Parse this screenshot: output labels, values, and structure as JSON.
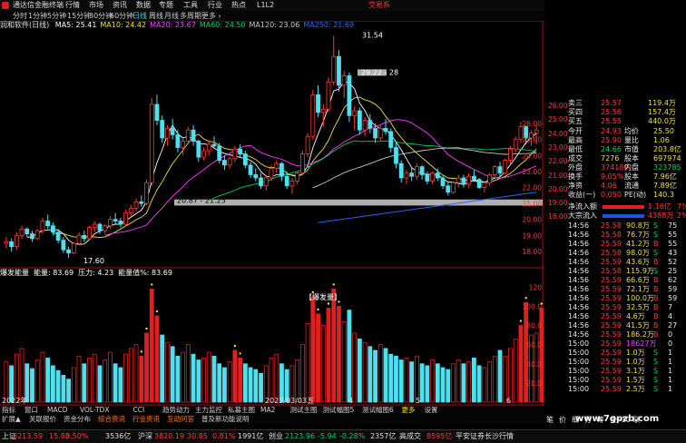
{
  "window": {
    "title": "通达信金融终端"
  },
  "menu": [
    "行情",
    "市场",
    "资讯",
    "数据",
    "专题",
    "工具",
    "行业",
    "热点",
    "L1L2"
  ],
  "menu_right": "交易系",
  "periods": [
    "分时",
    "1分钟",
    "5分钟",
    "15分钟",
    "30分钟",
    "60分钟",
    "日线",
    "周线",
    "月线",
    "多周期",
    "更多 ›"
  ],
  "ma_legend": {
    "name": "润和软件(日线)",
    "items": [
      {
        "t": "MA5: 25.41",
        "c": "#ffffff"
      },
      {
        "t": "MA10: 24.42",
        "c": "#f0e040"
      },
      {
        "t": "MA20: 23.67",
        "c": "#ff40ff"
      },
      {
        "t": "MA60: 24.50",
        "c": "#00d05a"
      },
      {
        "t": "MA120: 23.06",
        "c": "#c8c8c8"
      },
      {
        "t": "MA250: 21.69",
        "c": "#3060ff"
      }
    ]
  },
  "price_annotations": {
    "high": "31.54",
    "band": "29.22 - 28",
    "low": "17.60",
    "support": "20.87 - 21.25"
  },
  "axis_price": [
    "26.00",
    "25.00",
    "24.00",
    "23.00",
    "22.00",
    "21.00",
    "20.00",
    "19.00",
    "18.00"
  ],
  "axis_vol": [
    "120",
    "100.0",
    "80.0",
    "60.0",
    "40.0",
    "20.0"
  ],
  "vol_legend": {
    "items": [
      {
        "t": "爆发能量",
        "c": "#ffffff"
      },
      {
        "t": "能量: 83.69",
        "c": "#ffffff"
      },
      {
        "t": "压力: 4.23",
        "c": "#ffffff"
      },
      {
        "t": "能量值%: 83.69",
        "c": "#ffffff"
      }
    ]
  },
  "vol_signal": "【爆发量】",
  "xaxis": {
    "d1": "2022年",
    "d2": "2023/03/03五",
    "m4": "4",
    "m5": "5",
    "m6": "6"
  },
  "tabs": [
    "指标",
    "窗口",
    "MACD",
    "VOL-TDX",
    "CCI",
    "趋势动力",
    "主力监控",
    "私募主图",
    "MA2",
    "测试主图",
    "测试幅图5",
    "测试幅图6",
    "更多",
    "设置"
  ],
  "tabs2": [
    "扩展▲",
    "关联报价",
    "资金分布",
    "综合资讯",
    "行业资讯",
    "互动问答",
    "普及新功能说明"
  ],
  "quote": {
    "asks": [
      {
        "l": "卖三",
        "p": "25.57",
        "v": "119.4万"
      },
      {
        "l": "买四",
        "p": "25.56",
        "v": "157.4万"
      },
      {
        "l": "买五",
        "p": "25.55",
        "v": "440.0万"
      }
    ],
    "stats": [
      {
        "a": "今开",
        "b": "24.93",
        "c": "均价",
        "d": "25.50"
      },
      {
        "a": "最高",
        "b": "25.90",
        "c": "量比",
        "d": "1.06"
      },
      {
        "a": "最低",
        "b": "24.66",
        "c": "市值",
        "d": "203.8亿"
      },
      {
        "a": "成交",
        "b": "7276",
        "c": "股本",
        "d": "697974"
      },
      {
        "a": "外盘",
        "b": "374189",
        "c": "内盘",
        "d": "323785"
      },
      {
        "a": "换手",
        "b": "9.05%",
        "c": "股本",
        "d": "7.96亿"
      },
      {
        "a": "净资",
        "b": "4.06",
        "c": "流通",
        "d": "7.89亿"
      },
      {
        "a": "收益(一)",
        "b": "0.050",
        "c": "PE(动)",
        "d": "140.3"
      }
    ],
    "flows": [
      {
        "l": "净流入额",
        "v": "1.16亿",
        "p": "7%"
      },
      {
        "l": "大宗流入",
        "v": "4388万",
        "p": "2%"
      }
    ],
    "ticks": [
      {
        "t": "14:56",
        "p": "25.58",
        "v": "90.8万",
        "f": "S",
        "n": "75"
      },
      {
        "t": "14:56",
        "p": "25.58",
        "v": "76.7万",
        "f": "S",
        "n": "55"
      },
      {
        "t": "14:56",
        "p": "25.59",
        "v": "41.2万",
        "f": "B",
        "n": "55"
      },
      {
        "t": "14:56",
        "p": "25.58",
        "v": "98.0万",
        "f": "S",
        "n": "43"
      },
      {
        "t": "14:56",
        "p": "25.59",
        "v": "43.6万",
        "f": "B",
        "n": "52"
      },
      {
        "t": "14:56",
        "p": "25.58",
        "v": "115.9万",
        "f": "S",
        "n": "25"
      },
      {
        "t": "14:56",
        "p": "25.59",
        "v": "66.6万",
        "f": "B",
        "n": "62"
      },
      {
        "t": "14:56",
        "p": "25.59",
        "v": "72.1万",
        "f": "B",
        "n": "59"
      },
      {
        "t": "14:56",
        "p": "25.59",
        "v": "100.0万",
        "f": "B",
        "n": "59"
      },
      {
        "t": "14:56",
        "p": "25.59",
        "v": "32.5万",
        "f": "B",
        "n": "7"
      },
      {
        "t": "14:56",
        "p": "25.59",
        "v": "4.6万",
        "f": "B",
        "n": "4"
      },
      {
        "t": "14:56",
        "p": "25.59",
        "v": "41.5万",
        "f": "B",
        "n": "27"
      },
      {
        "t": "14:56",
        "p": "25.59",
        "v": "186.2万",
        "f": "B",
        "n": "0"
      },
      {
        "t": "15:00",
        "p": "25.59",
        "v": "18627万",
        "f": "",
        "n": "0"
      },
      {
        "t": "15:00",
        "p": "25.59",
        "v": "1.0万",
        "f": "S",
        "n": "1"
      },
      {
        "t": "15:00",
        "p": "25.59",
        "v": "1.0万",
        "f": "S",
        "n": "1"
      },
      {
        "t": "15:00",
        "p": "25.59",
        "v": "3.1万",
        "f": "S",
        "n": "1"
      },
      {
        "t": "15:00",
        "p": "25.59",
        "v": "1.5万",
        "f": "S",
        "n": "1"
      },
      {
        "t": "15:00",
        "p": "25.59",
        "v": "2.5万",
        "f": "S",
        "n": "1"
      }
    ],
    "side_axis": [
      "26.00",
      "25.00",
      "24.00",
      "23.00",
      "22.00",
      "21.00",
      "20.00",
      "19.00",
      "18.00"
    ],
    "bottom": {
      "a": "笔",
      "b": "价",
      "c": "细",
      "d": "分",
      "e": "筹",
      "f": "全F10 联"
    }
  },
  "status": [
    {
      "l": "上证",
      "v": "3213.59",
      "c": "15.83",
      "p": "0.50%",
      "amt": "3536亿"
    },
    {
      "l": "沪深",
      "v": "3820.19",
      "c": "30.85",
      "p": "0.81%",
      "amt": "1991亿"
    },
    {
      "l": "创业",
      "v": "2123.96",
      "c": "-5.94",
      "p": "-0.28%",
      "amt": "2357亿"
    },
    {
      "l": "高成交",
      "v": "8595亿",
      "c": "",
      "p": "",
      "amt": ""
    }
  ],
  "status_right": "平安证券长沙行情",
  "watermark": "www.7gpzb.com",
  "chart_data": {
    "type": "candlestick",
    "ylim": [
      17.2,
      32.2
    ],
    "candles": [
      [
        18.5,
        18.9,
        18.2,
        18.6
      ],
      [
        18.6,
        18.8,
        18.0,
        18.3
      ],
      [
        18.3,
        19.2,
        18.1,
        19.0
      ],
      [
        19.0,
        19.6,
        18.8,
        19.4
      ],
      [
        19.4,
        19.5,
        18.9,
        19.1
      ],
      [
        19.1,
        19.3,
        18.6,
        18.8
      ],
      [
        18.8,
        19.4,
        18.7,
        19.3
      ],
      [
        19.3,
        20.1,
        19.1,
        19.9
      ],
      [
        19.9,
        20.3,
        19.4,
        19.6
      ],
      [
        19.6,
        19.8,
        19.0,
        19.2
      ],
      [
        19.2,
        19.4,
        18.5,
        18.7
      ],
      [
        18.7,
        18.9,
        17.9,
        18.1
      ],
      [
        18.1,
        18.3,
        17.6,
        17.9
      ],
      [
        17.9,
        18.6,
        17.8,
        18.5
      ],
      [
        18.5,
        19.2,
        18.4,
        19.0
      ],
      [
        19.0,
        19.3,
        18.6,
        18.8
      ],
      [
        18.8,
        19.6,
        18.7,
        19.5
      ],
      [
        19.5,
        19.9,
        19.2,
        19.7
      ],
      [
        19.7,
        19.8,
        19.1,
        19.3
      ],
      [
        19.3,
        19.7,
        19.1,
        19.6
      ],
      [
        19.6,
        20.2,
        19.4,
        20.0
      ],
      [
        20.0,
        20.4,
        19.7,
        19.9
      ],
      [
        19.9,
        20.1,
        19.5,
        19.7
      ],
      [
        19.7,
        20.6,
        19.6,
        20.4
      ],
      [
        20.4,
        20.9,
        20.2,
        20.7
      ],
      [
        20.7,
        21.3,
        20.5,
        21.1
      ],
      [
        21.1,
        21.5,
        20.8,
        21.0
      ],
      [
        21.0,
        22.5,
        20.9,
        22.3
      ],
      [
        22.3,
        27.6,
        22.1,
        27.2
      ],
      [
        27.2,
        27.8,
        25.9,
        26.2
      ],
      [
        26.2,
        26.5,
        24.8,
        25.1
      ],
      [
        25.1,
        25.9,
        24.6,
        25.7
      ],
      [
        25.7,
        26.3,
        25.0,
        25.3
      ],
      [
        25.3,
        25.6,
        24.2,
        24.5
      ],
      [
        24.5,
        25.1,
        24.0,
        24.9
      ],
      [
        24.9,
        25.8,
        24.7,
        25.6
      ],
      [
        25.6,
        25.9,
        24.6,
        24.9
      ],
      [
        24.9,
        25.0,
        23.6,
        23.9
      ],
      [
        23.9,
        24.5,
        23.7,
        24.3
      ],
      [
        24.3,
        24.9,
        24.0,
        24.7
      ],
      [
        24.7,
        25.2,
        24.4,
        24.6
      ],
      [
        24.6,
        24.8,
        23.5,
        23.7
      ],
      [
        23.7,
        24.0,
        23.1,
        23.4
      ],
      [
        23.4,
        23.9,
        23.2,
        23.8
      ],
      [
        23.8,
        24.6,
        23.6,
        24.4
      ],
      [
        24.4,
        24.7,
        23.9,
        24.1
      ],
      [
        24.1,
        24.3,
        23.2,
        23.4
      ],
      [
        23.4,
        23.6,
        22.6,
        22.8
      ],
      [
        22.8,
        23.2,
        22.4,
        22.6
      ],
      [
        22.6,
        22.9,
        21.9,
        22.1
      ],
      [
        22.1,
        22.8,
        21.8,
        22.6
      ],
      [
        22.6,
        23.4,
        22.4,
        23.2
      ],
      [
        23.2,
        23.7,
        22.9,
        23.5
      ],
      [
        23.5,
        23.6,
        22.4,
        22.7
      ],
      [
        22.7,
        23.0,
        21.9,
        22.1
      ],
      [
        22.1,
        22.6,
        21.6,
        22.4
      ],
      [
        22.4,
        23.0,
        22.2,
        22.9
      ],
      [
        22.9,
        24.3,
        22.8,
        24.1
      ],
      [
        24.1,
        25.4,
        23.9,
        25.2
      ],
      [
        25.2,
        28.1,
        25.0,
        27.8
      ],
      [
        27.8,
        28.4,
        26.4,
        26.7
      ],
      [
        26.7,
        27.2,
        25.8,
        26.9
      ],
      [
        26.9,
        28.9,
        26.7,
        28.6
      ],
      [
        28.6,
        31.5,
        28.4,
        30.2
      ],
      [
        30.2,
        30.6,
        28.0,
        28.4
      ],
      [
        28.4,
        29.3,
        27.6,
        29.0
      ],
      [
        29.0,
        29.2,
        26.1,
        26.5
      ],
      [
        26.5,
        27.1,
        25.6,
        26.8
      ],
      [
        26.8,
        27.0,
        25.3,
        25.6
      ],
      [
        25.6,
        26.4,
        25.2,
        26.2
      ],
      [
        26.2,
        26.6,
        25.4,
        25.7
      ],
      [
        25.7,
        26.0,
        24.8,
        25.1
      ],
      [
        25.1,
        25.9,
        24.9,
        25.7
      ],
      [
        25.7,
        26.3,
        25.3,
        25.5
      ],
      [
        25.5,
        25.7,
        24.2,
        24.5
      ],
      [
        24.5,
        24.8,
        23.2,
        23.5
      ],
      [
        23.5,
        23.7,
        22.3,
        22.6
      ],
      [
        22.6,
        23.1,
        22.2,
        22.9
      ],
      [
        22.9,
        23.3,
        22.4,
        22.7
      ],
      [
        22.7,
        23.5,
        22.5,
        23.3
      ],
      [
        23.3,
        23.4,
        22.5,
        22.8
      ],
      [
        22.8,
        23.0,
        22.2,
        22.4
      ],
      [
        22.4,
        23.0,
        22.2,
        22.9
      ],
      [
        22.9,
        23.2,
        22.4,
        22.6
      ],
      [
        22.6,
        22.8,
        21.9,
        22.1
      ],
      [
        22.1,
        22.3,
        21.5,
        21.7
      ],
      [
        21.7,
        22.4,
        21.6,
        22.3
      ],
      [
        22.3,
        22.8,
        22.0,
        22.6
      ],
      [
        22.6,
        22.8,
        22.0,
        22.2
      ],
      [
        22.2,
        22.9,
        22.0,
        22.7
      ],
      [
        22.7,
        23.1,
        22.4,
        22.5
      ],
      [
        22.5,
        22.6,
        21.9,
        22.0
      ],
      [
        22.0,
        22.4,
        21.7,
        22.3
      ],
      [
        22.3,
        22.9,
        22.1,
        22.8
      ],
      [
        22.8,
        23.4,
        22.6,
        23.3
      ],
      [
        23.3,
        23.6,
        22.7,
        22.9
      ],
      [
        22.9,
        23.8,
        22.8,
        23.7
      ],
      [
        23.7,
        24.6,
        23.5,
        24.4
      ],
      [
        24.4,
        25.2,
        24.2,
        25.0
      ],
      [
        25.0,
        26.1,
        24.8,
        25.8
      ],
      [
        25.8,
        25.9,
        24.7,
        25.1
      ],
      [
        25.1,
        25.6,
        24.6,
        25.4
      ],
      [
        25.4,
        25.9,
        24.7,
        25.6
      ]
    ],
    "volume": [
      42,
      38,
      50,
      56,
      40,
      35,
      44,
      52,
      46,
      38,
      33,
      28,
      24,
      36,
      48,
      40,
      46,
      50,
      38,
      44,
      52,
      40,
      36,
      50,
      56,
      60,
      48,
      72,
      118,
      90,
      70,
      62,
      58,
      48,
      52,
      60,
      50,
      44,
      46,
      52,
      48,
      40,
      36,
      42,
      54,
      46,
      40,
      36,
      34,
      30,
      38,
      46,
      50,
      40,
      34,
      38,
      44,
      60,
      82,
      110,
      92,
      80,
      98,
      118,
      100,
      84,
      96,
      72,
      66,
      62,
      58,
      54,
      60,
      56,
      50,
      48,
      44,
      46,
      42,
      48,
      40,
      38,
      44,
      40,
      36,
      34,
      40,
      44,
      40,
      42,
      46,
      38,
      36,
      42,
      48,
      54,
      48,
      56,
      66,
      80,
      104,
      70,
      72,
      98
    ],
    "hot": [
      26,
      27,
      28,
      29,
      44,
      45,
      59,
      60,
      62,
      63,
      64,
      99,
      100,
      103
    ]
  }
}
